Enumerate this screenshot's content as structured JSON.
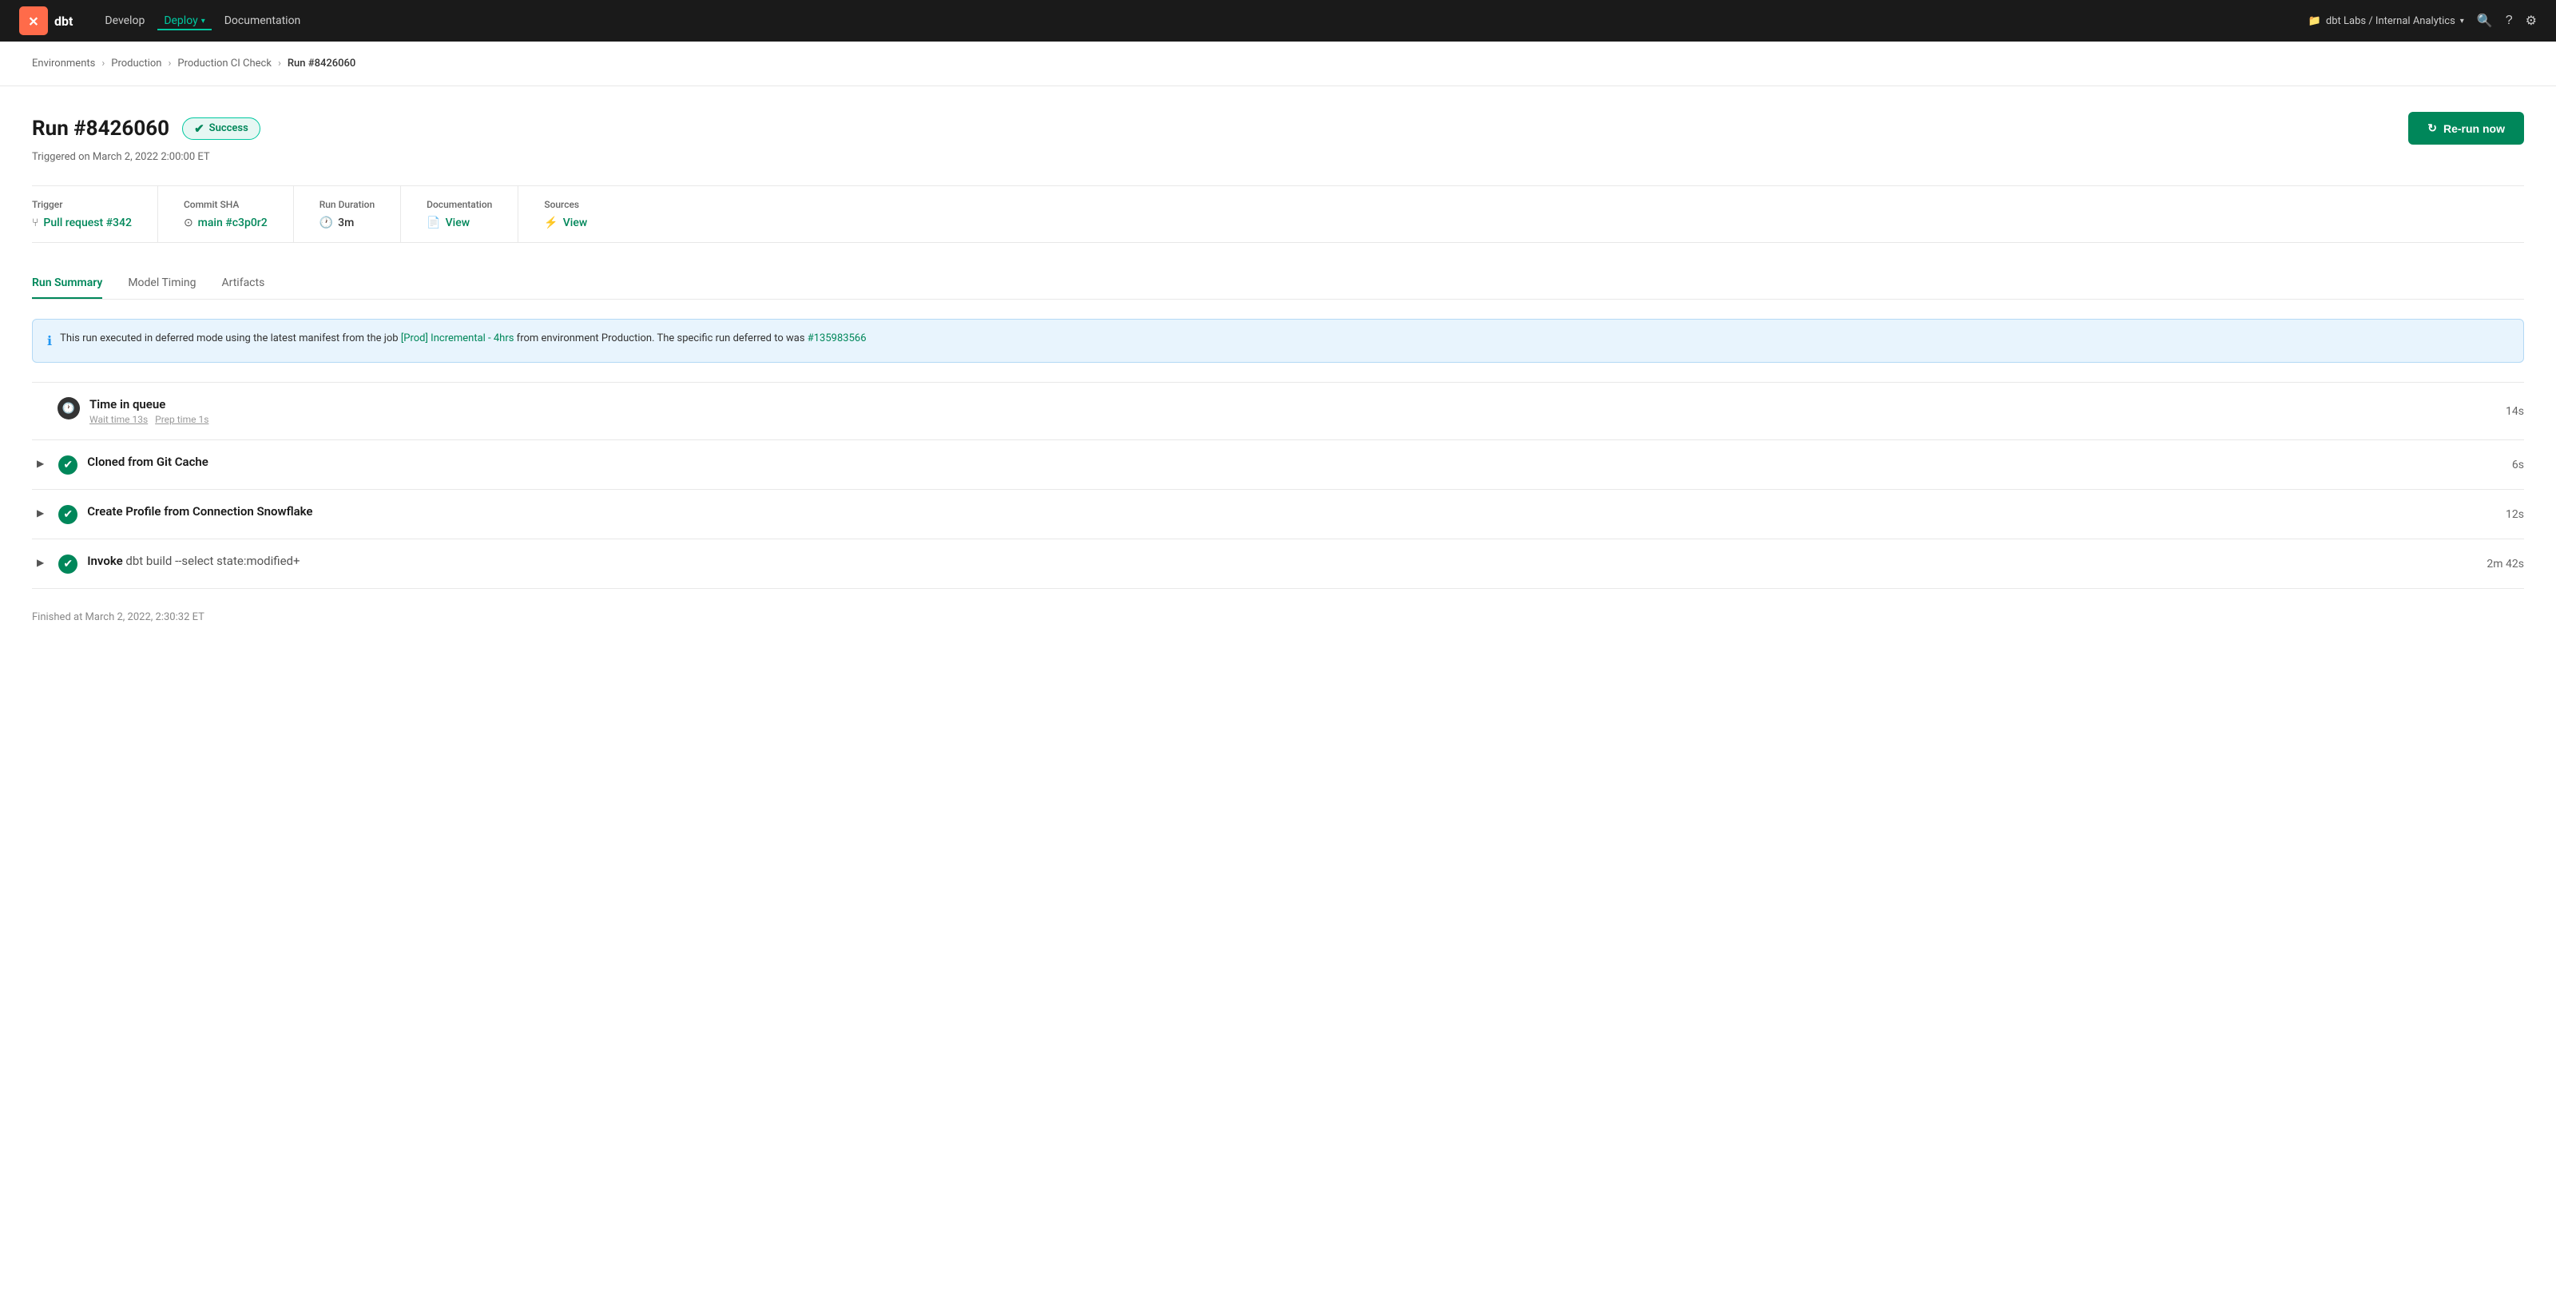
{
  "nav": {
    "logo_alt": "dbt logo",
    "links": [
      {
        "label": "Develop",
        "active": false
      },
      {
        "label": "Deploy",
        "active": true,
        "has_dropdown": true
      },
      {
        "label": "Documentation",
        "active": false
      }
    ],
    "project": "dbt Labs / Internal Analytics",
    "icons": [
      "search",
      "help",
      "settings"
    ]
  },
  "breadcrumb": {
    "items": [
      {
        "label": "Environments",
        "link": true
      },
      {
        "label": "Production",
        "link": true
      },
      {
        "label": "Production CI Check",
        "link": true
      },
      {
        "label": "Run #8426060",
        "link": false
      }
    ]
  },
  "run": {
    "title": "Run #8426060",
    "status": "Success",
    "triggered": "Triggered on March 2, 2022 2:00:00 ET",
    "rerun_label": "Re-run now",
    "meta": {
      "trigger_label": "Trigger",
      "trigger_value": "Pull request #342",
      "commit_label": "Commit SHA",
      "commit_value": "main #c3p0r2",
      "duration_label": "Run Duration",
      "duration_value": "3m",
      "docs_label": "Documentation",
      "docs_value": "View",
      "sources_label": "Sources",
      "sources_value": "View"
    },
    "tabs": [
      {
        "label": "Run Summary",
        "active": true
      },
      {
        "label": "Model Timing",
        "active": false
      },
      {
        "label": "Artifacts",
        "active": false
      }
    ],
    "info_banner": "This run executed in deferred mode using the latest manifest from the job [Prod] Incremental - 4hrs from environment Production. The specific run deferred to was #135983566",
    "info_banner_link1_text": "[Prod] Incremental - 4hrs",
    "info_banner_link2_text": "#135983566",
    "steps": [
      {
        "id": "queue",
        "title": "Time in queue",
        "subtitle": "Wait time 13s   Prep time 1s",
        "duration": "14s",
        "expandable": false,
        "type": "queue"
      },
      {
        "id": "clone",
        "title": "Cloned from Git Cache",
        "subtitle": "",
        "duration": "6s",
        "expandable": true,
        "type": "success"
      },
      {
        "id": "profile",
        "title": "Create Profile from Connection Snowflake",
        "subtitle": "",
        "duration": "12s",
        "expandable": true,
        "type": "success"
      },
      {
        "id": "invoke",
        "title": "Invoke",
        "cmd": " dbt build --select state:modified+",
        "subtitle": "",
        "duration": "2m 42s",
        "expandable": true,
        "type": "success"
      }
    ],
    "finished": "Finished at March 2, 2022, 2:30:32 ET"
  }
}
